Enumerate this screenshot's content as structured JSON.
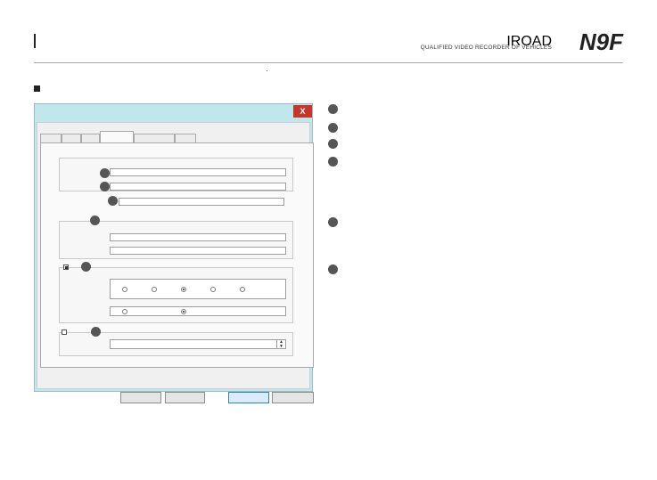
{
  "header": {
    "brand_name": "IROAD",
    "model": "N9F",
    "tagline": "QUALIFIED VIDEO RECORDER OF VEHICLES"
  },
  "dialog": {
    "close_label": "X"
  },
  "callouts": [
    1,
    2,
    3,
    4,
    5,
    6
  ]
}
